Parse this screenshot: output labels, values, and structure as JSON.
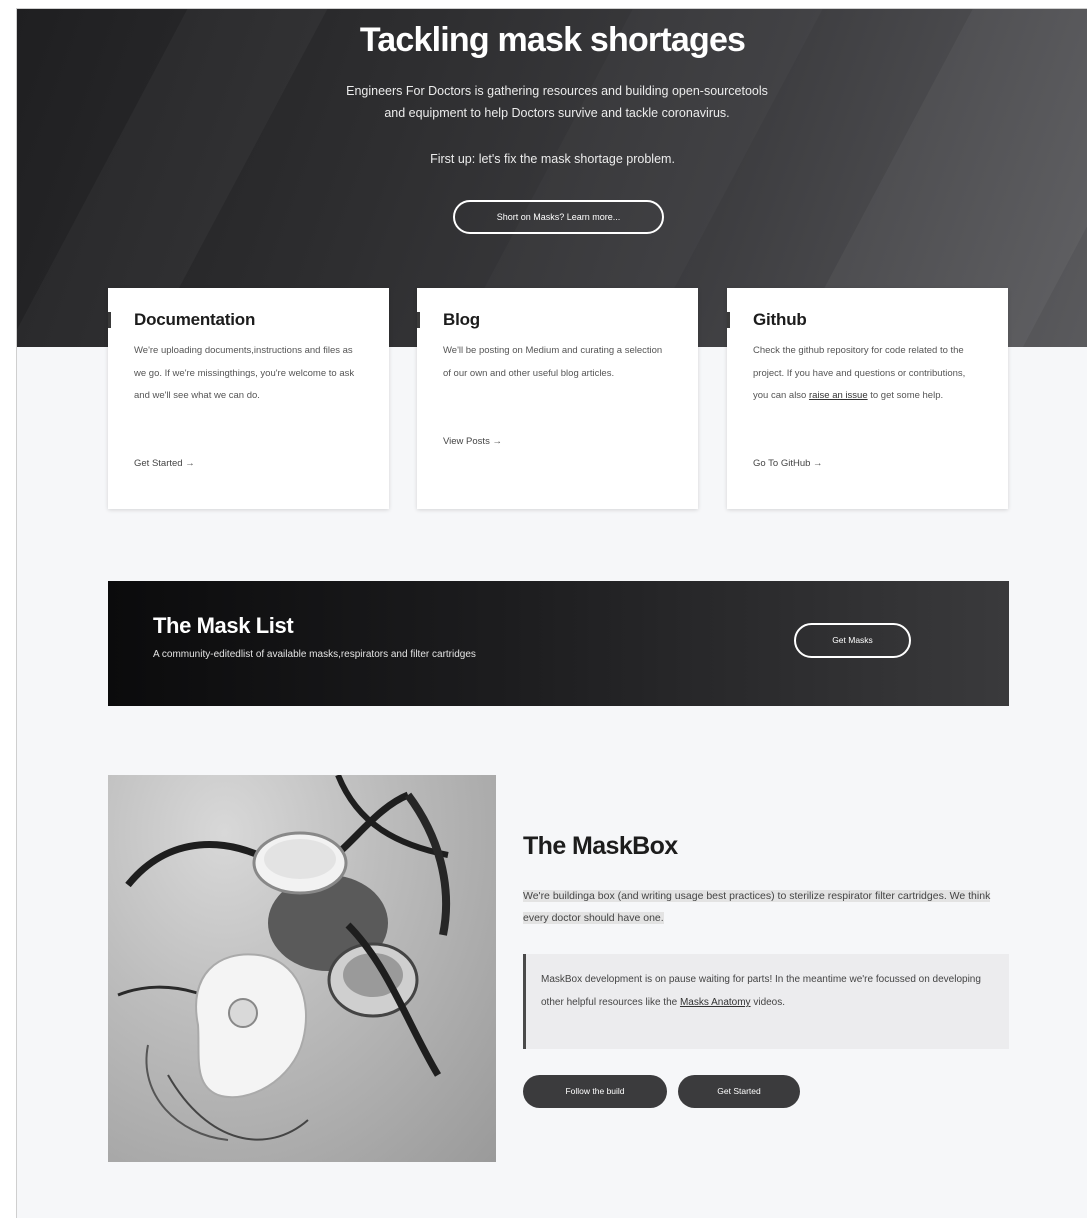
{
  "hero": {
    "title": "Tackling mask shortages",
    "description_line1": "Engineers For Doctors is gathering resources and building open-sourcetools",
    "description_line2": "and equipment to help Doctors survive and tackle coronavirus.",
    "sub": "First up: let's fix the mask shortage problem.",
    "button": "Short on Masks? Learn more..."
  },
  "cards": [
    {
      "title": "Documentation",
      "text": "We're uploading documents,instructions and files as we go. If we're missingthings, you're welcome to ask and we'll see what we can do.",
      "link": "Get Started →"
    },
    {
      "title": "Blog",
      "text": "We'll be posting on Medium and curating a selection of our own and other useful blog articles.",
      "link": "View Posts →"
    },
    {
      "title": "Github",
      "text_before": "Check the github repository for code related to the project. If you have and questions or contributions, you can also ",
      "text_link": "raise an issue",
      "text_after": " to get some help.",
      "link": "Go To GitHub →"
    }
  ],
  "mask_list": {
    "title": "The Mask List",
    "description": "A community-editedlist of available masks,respirators and filter cartridges",
    "button": "Get Masks"
  },
  "maskbox": {
    "title": "The MaskBox",
    "description": "We're buildinga box (and writing usage best practices) to sterilize respirator filter cartridges. We think every doctor should have one.",
    "note_before": "MaskBox development is on pause waiting for parts! In the meantime we're focussed on developing other helpful resources like the ",
    "note_link": "Masks Anatomy",
    "note_after": " videos.",
    "button_follow": "Follow the build",
    "button_start": "Get Started"
  },
  "colors": {
    "hero_bg": "#2e2e30",
    "page_bg": "#f6f7f9",
    "pill_bg": "#3b3b3d"
  }
}
